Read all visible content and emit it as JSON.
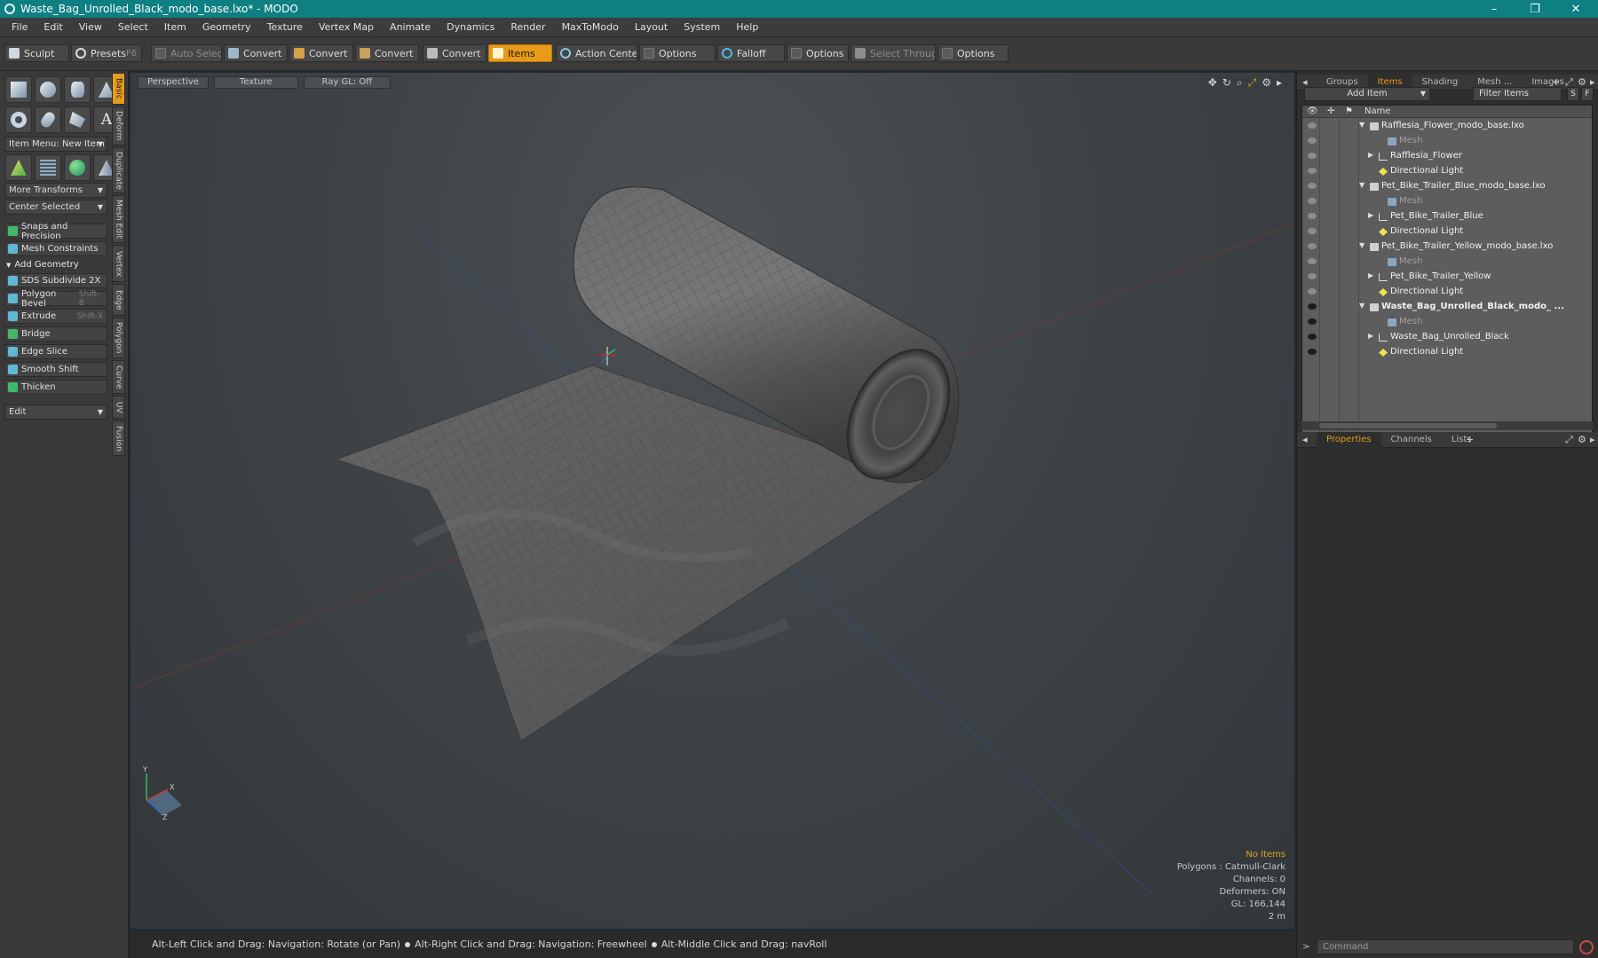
{
  "window": {
    "title": "Waste_Bag_Unrolled_Black_modo_base.lxo* - MODO",
    "minimize": "–",
    "maximize": "❐",
    "close": "✕"
  },
  "menu": [
    "File",
    "Edit",
    "View",
    "Select",
    "Item",
    "Geometry",
    "Texture",
    "Vertex Map",
    "Animate",
    "Dynamics",
    "Render",
    "MaxToModo",
    "Layout",
    "System",
    "Help"
  ],
  "toolbar": {
    "sculpt": "Sculpt",
    "presets": "Presets",
    "presets_shortcut": "F6",
    "auto_select": "Auto Select",
    "convert": "Convert",
    "items": "Items",
    "action_center": "Action Center",
    "options": "Options",
    "falloff": "Falloff",
    "select_through": "Select Through"
  },
  "left_panel": {
    "item_menu": "Item Menu: New Item",
    "more_transforms": "More Transforms",
    "center_selected": "Center Selected",
    "snaps": "Snaps and Precision",
    "mesh_constraints": "Mesh Constraints",
    "add_geometry": "Add Geometry",
    "tools": [
      {
        "label": "SDS Subdivide 2X",
        "shortcut": ""
      },
      {
        "label": "Polygon Bevel",
        "shortcut": "Shift-B"
      },
      {
        "label": "Extrude",
        "shortcut": "Shift-X"
      },
      {
        "label": "Bridge",
        "shortcut": ""
      },
      {
        "label": "Edge Slice",
        "shortcut": ""
      },
      {
        "label": "Smooth Shift",
        "shortcut": ""
      },
      {
        "label": "Thicken",
        "shortcut": ""
      }
    ],
    "edit": "Edit",
    "vtabs": [
      "Basic",
      "Deform",
      "Duplicate",
      "Mesh Edit",
      "Vertex",
      "Edge",
      "Polygon",
      "Curve",
      "UV",
      "Fusion"
    ]
  },
  "viewport": {
    "tabs": [
      "Perspective",
      "Texture",
      "Ray GL: Off"
    ],
    "stats": {
      "selection": "No Items",
      "polygons": "Polygons : Catmull-Clark",
      "channels": "Channels: 0",
      "deformers": "Deformers: ON",
      "gl": "GL: 166,144",
      "scale": "2 m"
    },
    "axis": {
      "y": "Y",
      "x": "X",
      "z": "Z"
    }
  },
  "right_panel": {
    "top_tabs": [
      "Groups",
      "Items",
      "Shading",
      "Mesh ...",
      "Images"
    ],
    "add_item": "Add Item",
    "filter_items": "Filter Items",
    "btn_s": "S",
    "btn_f": "F",
    "column_name": "Name",
    "items": [
      {
        "label": "Rafflesia_Flower_modo_base.lxo",
        "type": "scene",
        "indent": 0,
        "expand": "▼",
        "visible": false,
        "bold": false,
        "dim": false
      },
      {
        "label": "Mesh",
        "type": "mesh",
        "indent": 2,
        "expand": "",
        "visible": false,
        "bold": false,
        "dim": true
      },
      {
        "label": "Rafflesia_Flower",
        "type": "loc",
        "indent": 1,
        "expand": "▶",
        "visible": false,
        "bold": false,
        "dim": false
      },
      {
        "label": "Directional Light",
        "type": "light",
        "indent": 1,
        "expand": "",
        "visible": false,
        "bold": false,
        "dim": false
      },
      {
        "label": "Pet_Bike_Trailer_Blue_modo_base.lxo",
        "type": "scene",
        "indent": 0,
        "expand": "▼",
        "visible": false,
        "bold": false,
        "dim": false
      },
      {
        "label": "Mesh",
        "type": "mesh",
        "indent": 2,
        "expand": "",
        "visible": false,
        "bold": false,
        "dim": true
      },
      {
        "label": "Pet_Bike_Trailer_Blue",
        "type": "loc",
        "indent": 1,
        "expand": "▶",
        "visible": false,
        "bold": false,
        "dim": false
      },
      {
        "label": "Directional Light",
        "type": "light",
        "indent": 1,
        "expand": "",
        "visible": false,
        "bold": false,
        "dim": false
      },
      {
        "label": "Pet_Bike_Trailer_Yellow_modo_base.lxo",
        "type": "scene",
        "indent": 0,
        "expand": "▼",
        "visible": false,
        "bold": false,
        "dim": false
      },
      {
        "label": "Mesh",
        "type": "mesh",
        "indent": 2,
        "expand": "",
        "visible": false,
        "bold": false,
        "dim": true
      },
      {
        "label": "Pet_Bike_Trailer_Yellow",
        "type": "loc",
        "indent": 1,
        "expand": "▶",
        "visible": false,
        "bold": false,
        "dim": false
      },
      {
        "label": "Directional Light",
        "type": "light",
        "indent": 1,
        "expand": "",
        "visible": false,
        "bold": false,
        "dim": false
      },
      {
        "label": "Waste_Bag_Unrolled_Black_modo_ ...",
        "type": "scene",
        "indent": 0,
        "expand": "▼",
        "visible": true,
        "bold": true,
        "dim": false
      },
      {
        "label": "Mesh",
        "type": "mesh",
        "indent": 2,
        "expand": "",
        "visible": true,
        "bold": false,
        "dim": true
      },
      {
        "label": "Waste_Bag_Unrolled_Black",
        "type": "loc",
        "indent": 1,
        "expand": "▶",
        "visible": true,
        "bold": false,
        "dim": false
      },
      {
        "label": "Directional Light",
        "type": "light",
        "indent": 1,
        "expand": "",
        "visible": true,
        "bold": false,
        "dim": false
      }
    ],
    "bottom_tabs": [
      "Properties",
      "Channels",
      "Lists"
    ],
    "command_placeholder": "Command"
  },
  "status": {
    "hint1": "Alt-Left Click and Drag: Navigation: Rotate (or Pan)",
    "hint2": "Alt-Right Click and Drag: Navigation: Freewheel",
    "hint3": "Alt-Middle Click and Drag: navRoll"
  },
  "colors": {
    "accent": "#e79b1b",
    "titlebar": "#0e7f82",
    "viewport": "#3e4347"
  }
}
